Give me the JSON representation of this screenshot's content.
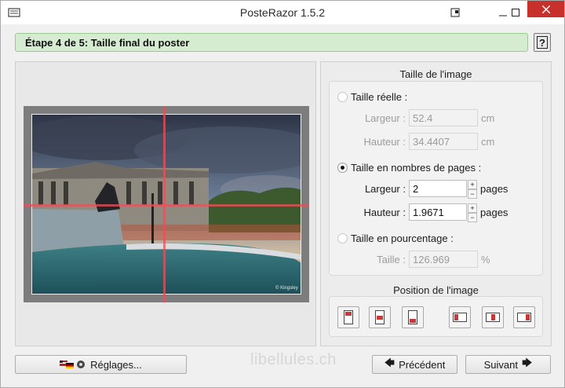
{
  "window": {
    "title": "PosteRazor 1.5.2"
  },
  "step": {
    "title": "Étape 4 de 5: Taille final du poster",
    "help_label": "?"
  },
  "image_size": {
    "title": "Taille de l'image",
    "real_size": {
      "label": "Taille réelle :",
      "width_label": "Largeur :",
      "width_value": "52.4",
      "width_unit": "cm",
      "height_label": "Hauteur :",
      "height_value": "34.4407",
      "height_unit": "cm",
      "selected": false
    },
    "pages": {
      "label": "Taille en nombres de pages :",
      "width_label": "Largeur :",
      "width_value": "2",
      "width_unit": "pages",
      "height_label": "Hauteur :",
      "height_value": "1.9671",
      "height_unit": "pages",
      "selected": true
    },
    "percent": {
      "label": "Taille en pourcentage :",
      "size_label": "Taille :",
      "size_value": "126.969",
      "size_unit": "%",
      "selected": false
    }
  },
  "image_position": {
    "title": "Position de l'image",
    "buttons": [
      "top",
      "center",
      "bottom",
      "left",
      "middle",
      "right"
    ]
  },
  "preview": {
    "image_credit": "© Kingsley"
  },
  "footer": {
    "settings_label": "Réglages...",
    "watermark": "libellules.ch",
    "previous_label": "Précédent",
    "next_label": "Suivant"
  },
  "colors": {
    "header_bg": "#d6ecd1",
    "cut_line": "#e8505a",
    "close_button": "#c7302b"
  }
}
